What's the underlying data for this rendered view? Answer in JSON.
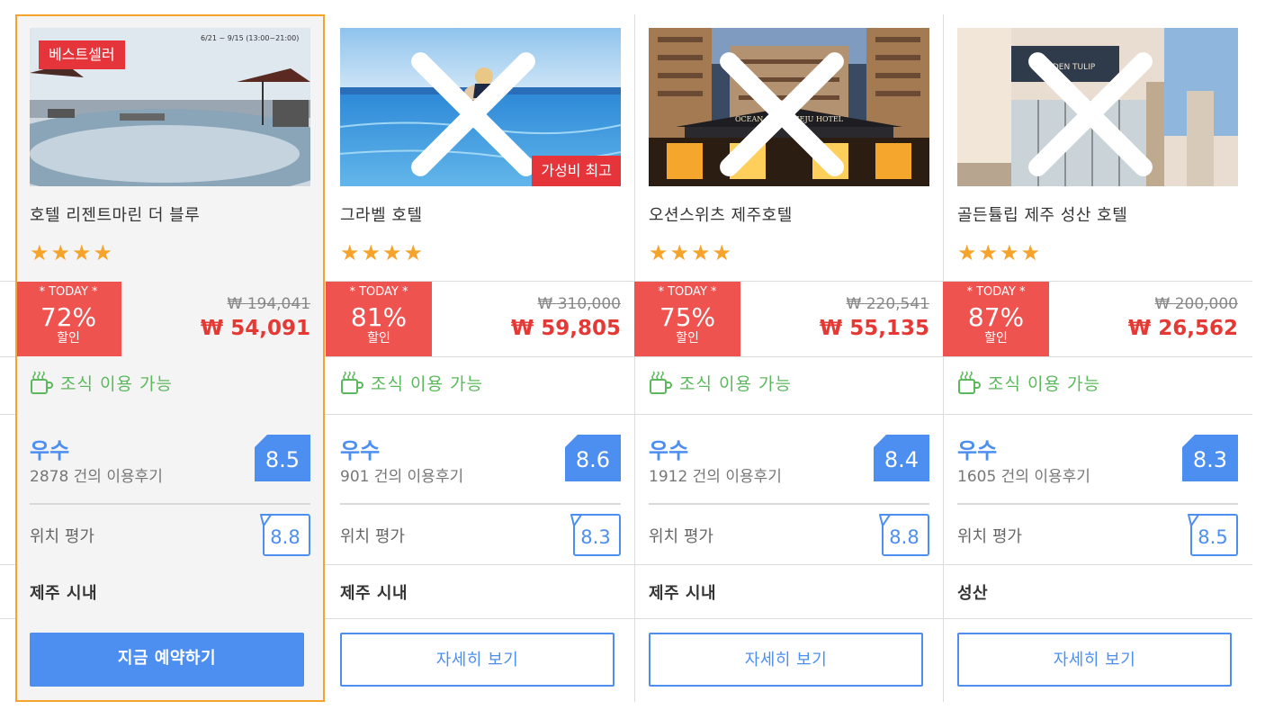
{
  "hotels": [
    {
      "name": "호텔 리젠트마린 더 블루",
      "stars": "★★★★",
      "badge": "베스트셀러",
      "photo_caption": "6/21 ~ 9/15 (13:00~21:00)",
      "today_label": "* TODAY *",
      "discount_pct": "72%",
      "discount_label": "할인",
      "original_price": "₩ 194,041",
      "sale_price": "₩ 54,091",
      "breakfast": "조식 이용 가능",
      "grade": "우수",
      "reviews": "2878 건의 이용후기",
      "score": "8.5",
      "location_label": "위치 평가",
      "location_score": "8.8",
      "area": "제주 시내",
      "button": "지금 예약하기"
    },
    {
      "name": "그라벨 호텔",
      "stars": "★★★★",
      "badge": "가성비 최고",
      "today_label": "* TODAY *",
      "discount_pct": "81%",
      "discount_label": "할인",
      "original_price": "₩ 310,000",
      "sale_price": "₩ 59,805",
      "breakfast": "조식 이용 가능",
      "grade": "우수",
      "reviews": "901 건의 이용후기",
      "score": "8.6",
      "location_label": "위치 평가",
      "location_score": "8.3",
      "area": "제주 시내",
      "button": "자세히 보기"
    },
    {
      "name": "오션스위츠 제주호텔",
      "stars": "★★★★",
      "photo_sign": "OCEAN SUITES JEJU HOTEL",
      "today_label": "* TODAY *",
      "discount_pct": "75%",
      "discount_label": "할인",
      "original_price": "₩ 220,541",
      "sale_price": "₩ 55,135",
      "breakfast": "조식 이용 가능",
      "grade": "우수",
      "reviews": "1912 건의 이용후기",
      "score": "8.4",
      "location_label": "위치 평가",
      "location_score": "8.8",
      "area": "제주 시내",
      "button": "자세히 보기"
    },
    {
      "name": "골든튤립 제주 성산 호텔",
      "stars": "★★★★",
      "photo_sign": "GOLDEN TULIP",
      "today_label": "* TODAY *",
      "discount_pct": "87%",
      "discount_label": "할인",
      "original_price": "₩ 200,000",
      "sale_price": "₩ 26,562",
      "breakfast": "조식 이용 가능",
      "grade": "우수",
      "reviews": "1605 건의 이용후기",
      "score": "8.3",
      "location_label": "위치 평가",
      "location_score": "8.5",
      "area": "성산",
      "button": "자세히 보기"
    }
  ],
  "colors": {
    "accent_blue": "#4d8ff0",
    "discount_red": "#ef5350",
    "price_red": "#e53935",
    "star_orange": "#f5a32a",
    "breakfast_green": "#5cb85c",
    "highlight_border": "#f5a32a"
  },
  "icons": {
    "close": "close-icon",
    "breakfast": "coffee-cup-icon",
    "star": "star-icon"
  }
}
